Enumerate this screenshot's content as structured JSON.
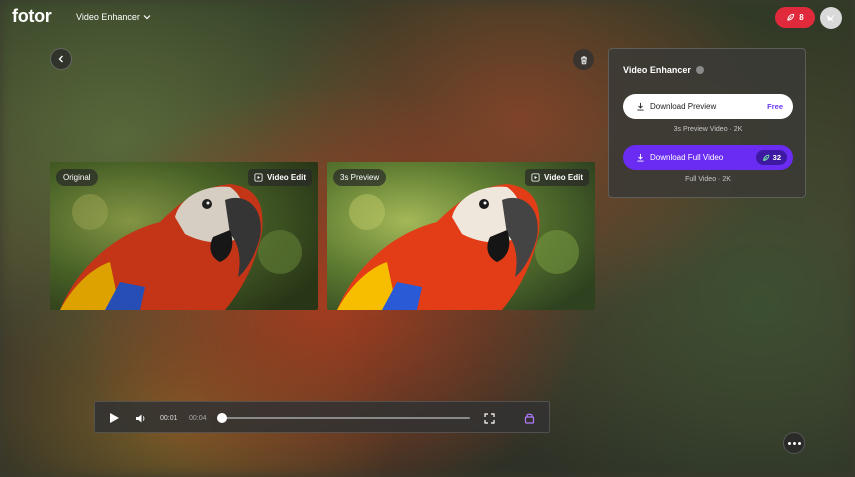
{
  "header": {
    "logo": "fotor",
    "tool_name": "Video Enhancer",
    "credits": "8"
  },
  "comparison": {
    "original_label": "Original",
    "preview_label": "3s Preview",
    "edit_label": "Video Edit"
  },
  "side_panel": {
    "title": "Video Enhancer",
    "download_preview_label": "Download Preview",
    "download_preview_price": "Free",
    "download_preview_sub": "3s Preview Video · 2K",
    "download_full_label": "Download Full Video",
    "download_full_cost": "32",
    "download_full_sub": "Full Video · 2K"
  },
  "player": {
    "current_time": "00:01",
    "total_time": "00:04",
    "progress": 0.0
  },
  "colors": {
    "accent": "#6a2bf2",
    "credits_red": "#e02a3c",
    "lock_purple": "#b07cff"
  }
}
